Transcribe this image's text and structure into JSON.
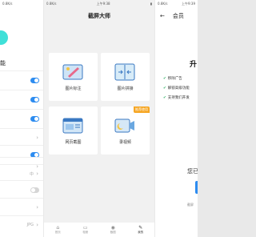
{
  "left": {
    "status_time": "0.8K/s",
    "section_title": "能",
    "rows": [
      {
        "type": "toggle",
        "on": true
      },
      {
        "type": "toggle",
        "on": true
      },
      {
        "type": "toggle",
        "on": true
      },
      {
        "type": "chevron"
      },
      {
        "type": "toggle",
        "on": true
      },
      {
        "type": "chevron"
      },
      {
        "type": "value",
        "value": "中"
      },
      {
        "type": "toggle",
        "on": false
      },
      {
        "type": "chevron"
      },
      {
        "type": "value",
        "value": "JPG"
      }
    ]
  },
  "middle": {
    "status_time": "上午9:38",
    "status_speed": "0.8K/s",
    "app_title": "截屏大师",
    "cards": [
      {
        "label": "图片标注",
        "icon": "pen-annotate-icon",
        "color": "#7fb8e8"
      },
      {
        "label": "图片拼接",
        "icon": "image-stitch-icon",
        "color": "#9bcbe8"
      },
      {
        "label": "网页截图",
        "icon": "webpage-capture-icon",
        "color": "#6aa7e0"
      },
      {
        "label": "录视频",
        "icon": "screen-record-icon",
        "color": "#8cbde6",
        "badge": "推荐使用"
      }
    ],
    "tabs": [
      {
        "label": "首页",
        "icon": "home-icon"
      },
      {
        "label": "相册",
        "icon": "album-icon"
      },
      {
        "label": "截图",
        "icon": "camera-icon"
      },
      {
        "label": "我的",
        "icon": "tools-icon",
        "active": true
      }
    ]
  },
  "right": {
    "status_time": "上午9:39",
    "status_speed": "0.8K/s",
    "title": "会员",
    "heading": "升",
    "features": [
      "移除广告",
      "解锁高级功能",
      "支持我们开发"
    ],
    "question": "您已",
    "footer": "截屏"
  }
}
